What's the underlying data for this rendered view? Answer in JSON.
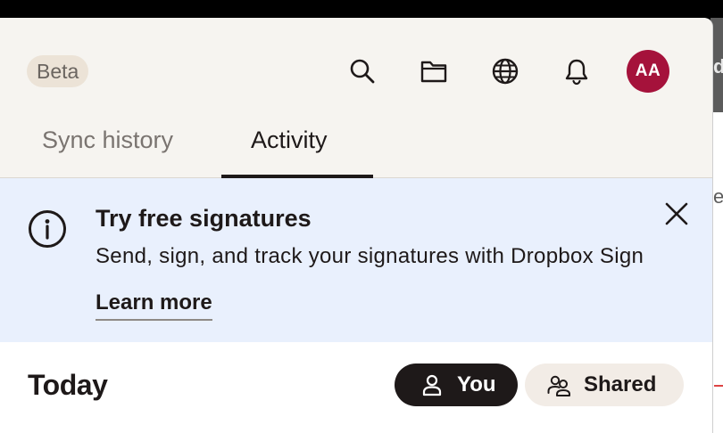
{
  "header": {
    "badge": "Beta",
    "icons": [
      "search-icon",
      "folder-icon",
      "globe-icon",
      "bell-icon"
    ],
    "avatar_initials": "AA",
    "avatar_color": "#a5123b"
  },
  "tabs": [
    {
      "label": "Sync history",
      "active": false
    },
    {
      "label": "Activity",
      "active": true
    }
  ],
  "banner": {
    "icon": "info-icon",
    "title": "Try free signatures",
    "description": "Send, sign, and track your signatures with Dropbox Sign",
    "link": "Learn more",
    "background": "#e9f0fd"
  },
  "activity": {
    "section_title": "Today",
    "filters": [
      {
        "label": "You",
        "icon": "person-icon",
        "selected": true
      },
      {
        "label": "Shared",
        "icon": "people-icon",
        "selected": false
      }
    ]
  },
  "colors": {
    "header_bg": "#f6f4f0",
    "text_primary": "#1e1919",
    "accent_dark": "#1e1919"
  }
}
